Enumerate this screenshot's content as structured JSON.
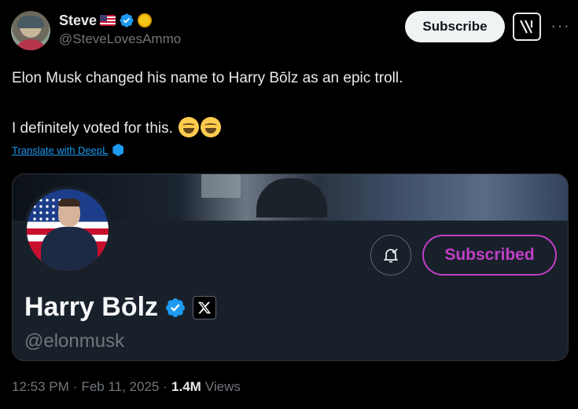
{
  "author": {
    "name": "Steve",
    "handle": "@SteveLovesAmmo",
    "flag_icon": "us-flag-icon",
    "verified_color": "#1d9bf0",
    "badge_icon": "gold-coin-icon"
  },
  "header": {
    "subscribe_label": "Subscribe",
    "grok_icon": "grok-icon",
    "more_label": "···"
  },
  "tweet": {
    "line1": "Elon Musk changed his name to Harry Bōlz as an epic troll.",
    "line2": "I definitely voted for this.",
    "emoji": "face-with-tears-of-joy",
    "translate_label": "Translate with DeepL"
  },
  "card": {
    "name": "Harry Bōlz",
    "handle": "@elonmusk",
    "subscribed_label": "Subscribed",
    "accent": "#c23fc7",
    "bell_icon": "notification-bell-check-icon",
    "x_icon": "x-logo-icon"
  },
  "footer": {
    "time": "12:53 PM",
    "separator": "·",
    "date": "Feb 11, 2025",
    "views_count": "1.4M",
    "views_label": "Views"
  }
}
